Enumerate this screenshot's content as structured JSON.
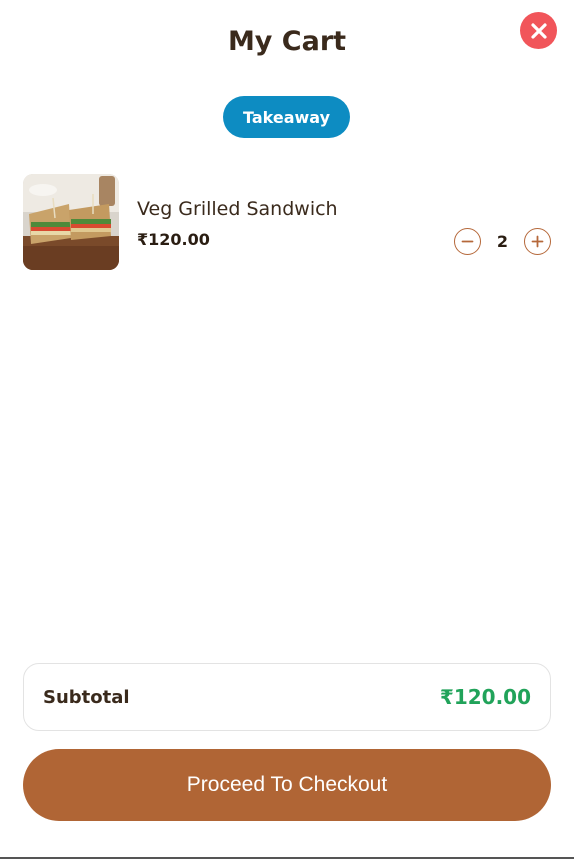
{
  "header": {
    "title": "My Cart",
    "close_icon": "close-icon"
  },
  "order_mode": "Takeaway",
  "items": [
    {
      "name": "Veg Grilled Sandwich",
      "price": "₹120.00",
      "quantity": "2",
      "image": "veg-grilled-sandwich-photo"
    }
  ],
  "summary": {
    "subtotal_label": "Subtotal",
    "subtotal_value": "₹120.00"
  },
  "checkout_label": "Proceed To Checkout",
  "colors": {
    "close": "#f1555a",
    "badge": "#0d8cc2",
    "accent": "#b06535",
    "qty_border": "#b5683a",
    "subtotal_value": "#21a35a",
    "text_dark": "#3a2a1c"
  }
}
